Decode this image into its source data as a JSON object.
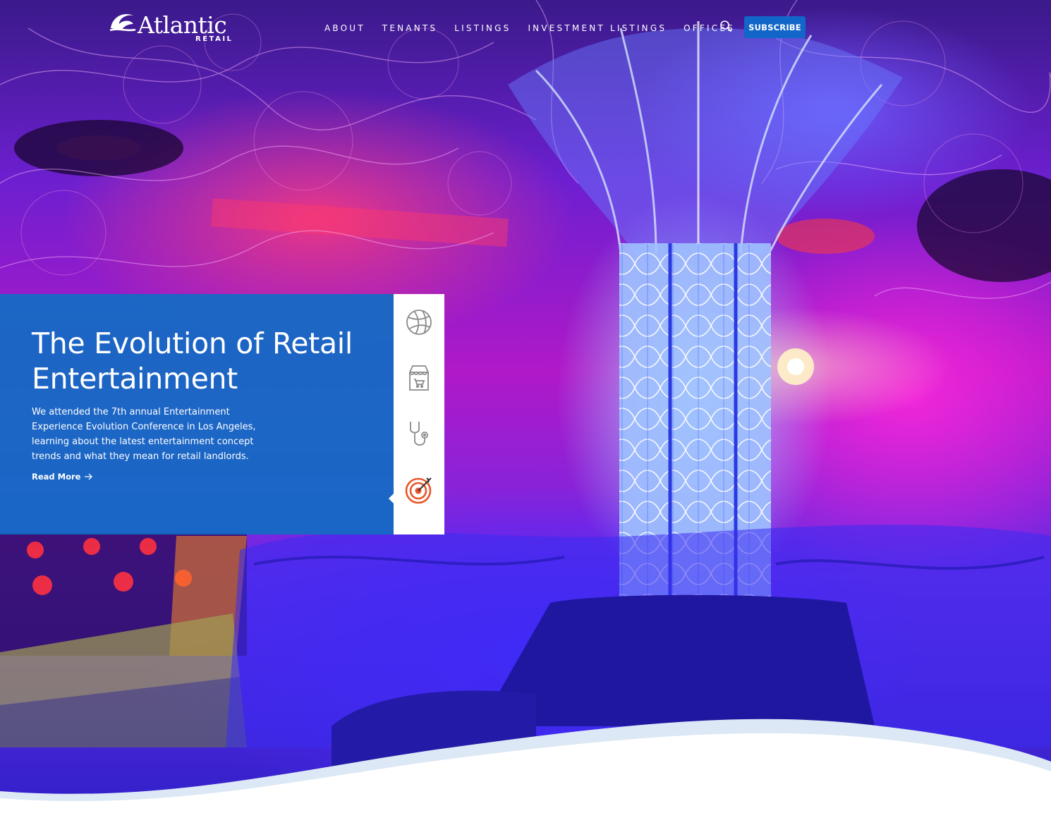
{
  "brand": {
    "name": "Atlantic",
    "sub": "RETAIL"
  },
  "nav": {
    "items": [
      {
        "label": "ABOUT"
      },
      {
        "label": "TENANTS"
      },
      {
        "label": "LISTINGS"
      },
      {
        "label": "INVESTMENT LISTINGS"
      },
      {
        "label": "OFFICES"
      }
    ],
    "search_icon": "search-icon",
    "subscribe_label": "SUBSCRIBE"
  },
  "feature": {
    "title": "The Evolution of Retail Entertainment",
    "body": "We attended the 7th annual Entertainment Experience Evolution Conference in Los Angeles, learning about the latest entertainment concept trends and what they mean for retail landlords.",
    "read_more": "Read More"
  },
  "categories": [
    {
      "icon": "basketball-icon",
      "active": false
    },
    {
      "icon": "storefront-cart-icon",
      "active": false
    },
    {
      "icon": "stethoscope-icon",
      "active": false
    },
    {
      "icon": "target-icon",
      "active": true
    }
  ],
  "colors": {
    "accent": "#1266c9",
    "card": "#126cc4",
    "active_icon": "#e8562a",
    "inactive_icon": "#8a8a8a"
  }
}
